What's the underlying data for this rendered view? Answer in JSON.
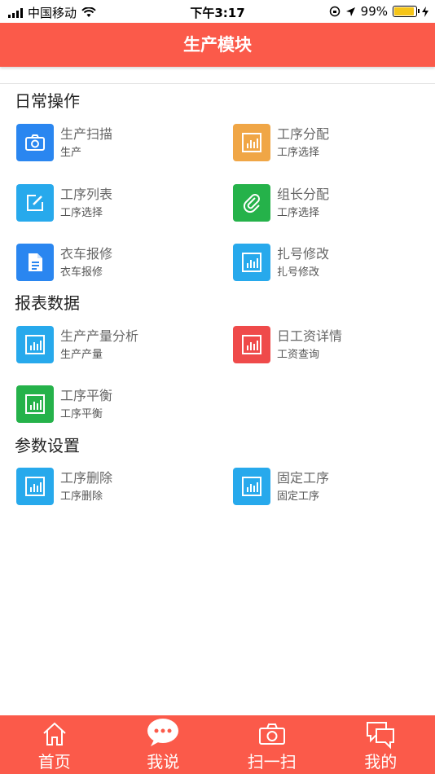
{
  "status": {
    "carrier": "中国移动",
    "time": "下午3:17",
    "battery": "99%"
  },
  "header": {
    "title": "生产模块"
  },
  "sections": [
    {
      "title": "日常操作",
      "items": [
        {
          "name": "生产扫描",
          "sub": "生产",
          "color": "#2a86f0",
          "icon": "camera-icon"
        },
        {
          "name": "工序分配",
          "sub": "工序选择",
          "color": "#f0a646",
          "icon": "bar-chart-icon"
        },
        {
          "name": "工序列表",
          "sub": "工序选择",
          "color": "#27a9ec",
          "icon": "edit-icon"
        },
        {
          "name": "组长分配",
          "sub": "工序选择",
          "color": "#25b24a",
          "icon": "paperclip-icon"
        },
        {
          "name": "衣车报修",
          "sub": "衣车报修",
          "color": "#2a86f0",
          "icon": "document-icon"
        },
        {
          "name": "扎号修改",
          "sub": "扎号修改",
          "color": "#27a9ec",
          "icon": "bar-chart-icon"
        }
      ]
    },
    {
      "title": "报表数据",
      "items": [
        {
          "name": "生产产量分析",
          "sub": "生产产量",
          "color": "#27a9ec",
          "icon": "bar-chart-icon"
        },
        {
          "name": "日工资详情",
          "sub": "工资查询",
          "color": "#ef4a4a",
          "icon": "bar-chart-icon"
        },
        {
          "name": "工序平衡",
          "sub": "工序平衡",
          "color": "#25b24a",
          "icon": "bar-chart-icon"
        }
      ]
    },
    {
      "title": "参数设置",
      "items": [
        {
          "name": "工序删除",
          "sub": "工序删除",
          "color": "#27a9ec",
          "icon": "bar-chart-icon"
        },
        {
          "name": "固定工序",
          "sub": "固定工序",
          "color": "#27a9ec",
          "icon": "bar-chart-icon"
        }
      ]
    }
  ],
  "tabs": [
    {
      "label": "首页",
      "icon": "home-icon"
    },
    {
      "label": "我说",
      "icon": "chat-bubble-icon"
    },
    {
      "label": "扫一扫",
      "icon": "camera-icon"
    },
    {
      "label": "我的",
      "icon": "messages-icon"
    }
  ]
}
